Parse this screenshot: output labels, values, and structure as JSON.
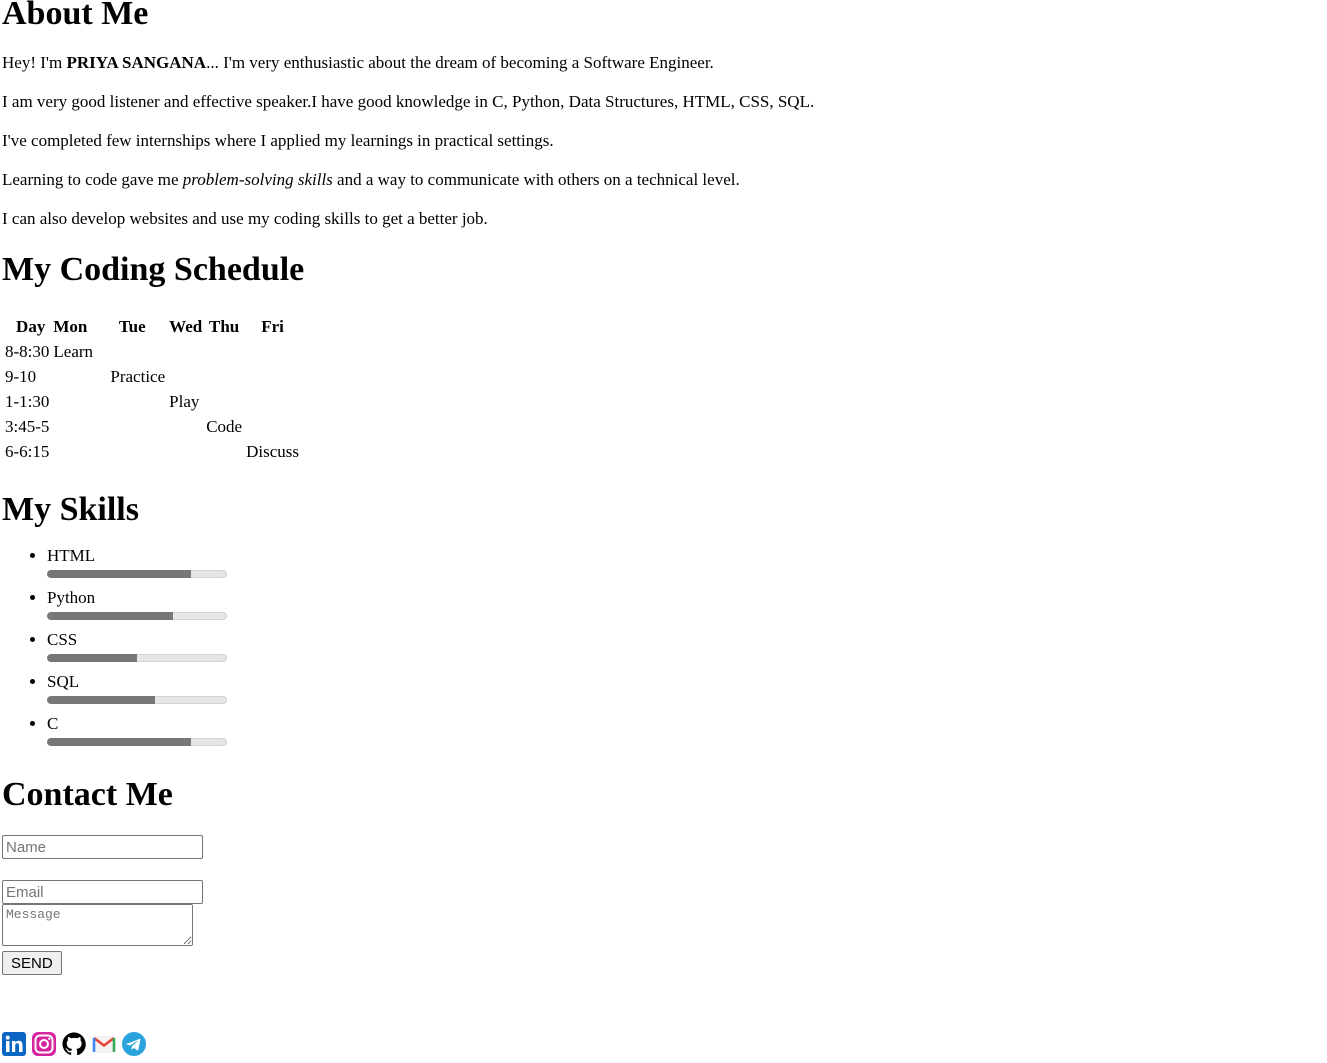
{
  "about": {
    "title": "About Me",
    "intro_prefix": "Hey! I'm ",
    "intro_name": "PRIYA SANGANA",
    "intro_suffix": "... I'm very enthusiastic about the dream of becoming a Software Engineer.",
    "line2": "I am very good listener and effective speaker.I have good knowledge in C, Python, Data Structures, HTML, CSS, SQL.",
    "line3": "I've completed few internships where I applied my learnings in practical settings.",
    "line4_prefix": "Learning to code gave me ",
    "line4_em": "problem-solving skills",
    "line4_suffix": " and a way to communicate with others on a technical level.",
    "line5": "I can also develop websites and use my coding skills to get a better job."
  },
  "schedule": {
    "title": "My Coding Schedule",
    "headers": [
      "Day",
      "Mon",
      "Tue",
      "Wed",
      "Thu",
      "Fri"
    ],
    "rows": [
      [
        "8-8:30",
        "Learn",
        "",
        "",
        "",
        ""
      ],
      [
        "9-10",
        "",
        "Practice",
        "",
        "",
        ""
      ],
      [
        "1-1:30",
        "",
        "",
        "Play",
        "",
        ""
      ],
      [
        "3:45-5",
        "",
        "",
        "",
        "Code",
        ""
      ],
      [
        "6-6:15",
        "",
        "",
        "",
        "",
        "Discuss"
      ]
    ]
  },
  "skills": {
    "title": "My Skills",
    "items": [
      {
        "label": "HTML",
        "level": 0.8
      },
      {
        "label": "Python",
        "level": 0.7
      },
      {
        "label": "CSS",
        "level": 0.5
      },
      {
        "label": "SQL",
        "level": 0.6
      },
      {
        "label": "C",
        "level": 0.8
      }
    ],
    "bar_fill_color": "#777777",
    "bar_track_color": "#e6e6e6"
  },
  "contact": {
    "title": "Contact Me",
    "name_placeholder": "Name",
    "email_placeholder": "Email",
    "message_placeholder": "Message",
    "send_label": "SEND"
  },
  "socials": [
    {
      "icon": "linkedin-icon",
      "color": "#0a66c2"
    },
    {
      "icon": "instagram-icon",
      "color": "#e1306c"
    },
    {
      "icon": "github-icon",
      "color": "#000000"
    },
    {
      "icon": "gmail-icon",
      "color": "#ea4335"
    },
    {
      "icon": "telegram-icon",
      "color": "#2aa3dd"
    }
  ]
}
